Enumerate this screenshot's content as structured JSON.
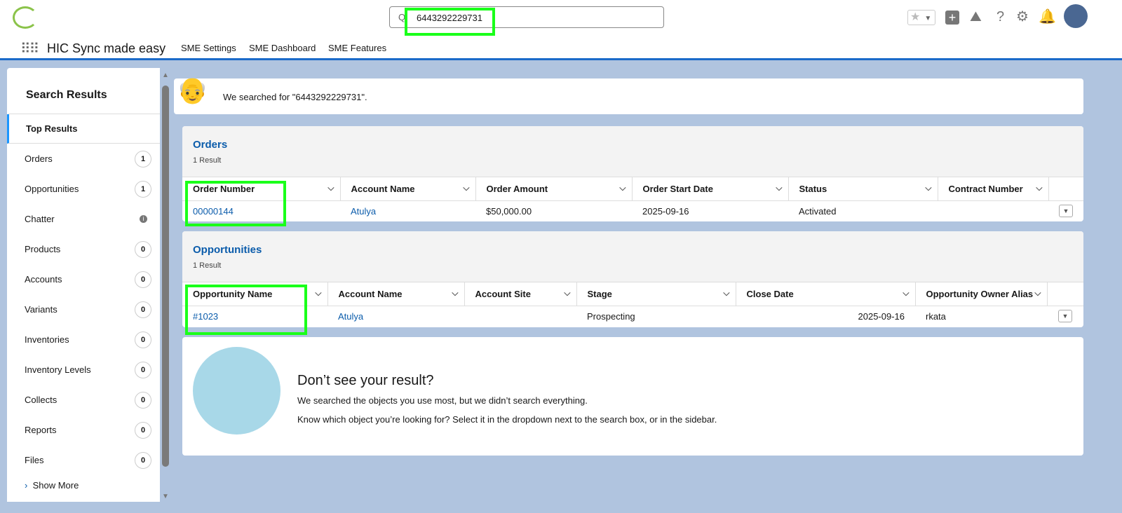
{
  "header": {
    "search_value": "6443292229731",
    "app_name": "HIC Sync made easy",
    "nav": [
      "SME Settings",
      "SME Dashboard",
      "SME Features"
    ]
  },
  "banner": {
    "text": "We searched for \"6443292229731\"."
  },
  "sidebar": {
    "title": "Search Results",
    "top": "Top Results",
    "items": [
      {
        "label": "Orders",
        "count": "1"
      },
      {
        "label": "Opportunities",
        "count": "1"
      },
      {
        "label": "Chatter",
        "count": ""
      },
      {
        "label": "Products",
        "count": "0"
      },
      {
        "label": "Accounts",
        "count": "0"
      },
      {
        "label": "Variants",
        "count": "0"
      },
      {
        "label": "Inventories",
        "count": "0"
      },
      {
        "label": "Inventory Levels",
        "count": "0"
      },
      {
        "label": "Collects",
        "count": "0"
      },
      {
        "label": "Reports",
        "count": "0"
      },
      {
        "label": "Files",
        "count": "0"
      }
    ],
    "show_more": "Show More"
  },
  "orders": {
    "title": "Orders",
    "count": "1 Result",
    "columns": [
      "Order Number",
      "Account Name",
      "Order Amount",
      "Order Start Date",
      "Status",
      "Contract Number"
    ],
    "rows": [
      [
        "00000144",
        "Atulya",
        "$50,000.00",
        "2025-09-16",
        "Activated",
        ""
      ]
    ]
  },
  "opportunities": {
    "title": "Opportunities",
    "count": "1 Result",
    "columns": [
      "Opportunity Name",
      "Account Name",
      "Account Site",
      "Stage",
      "Close Date",
      "Opportunity Owner Alias"
    ],
    "rows": [
      [
        "#1023",
        "Atulya",
        "",
        "Prospecting",
        "2025-09-16",
        "rkata"
      ]
    ]
  },
  "empty": {
    "title": "Don’t see your result?",
    "line1": "We searched the objects you use most, but we didn’t search everything.",
    "line2": "Know which object you’re looking for? Select it in the dropdown next to the search box, or in the sidebar."
  },
  "colors": {
    "accent": "#0b5cab",
    "highlight": "#1aff1a",
    "background": "#b0c4df"
  }
}
